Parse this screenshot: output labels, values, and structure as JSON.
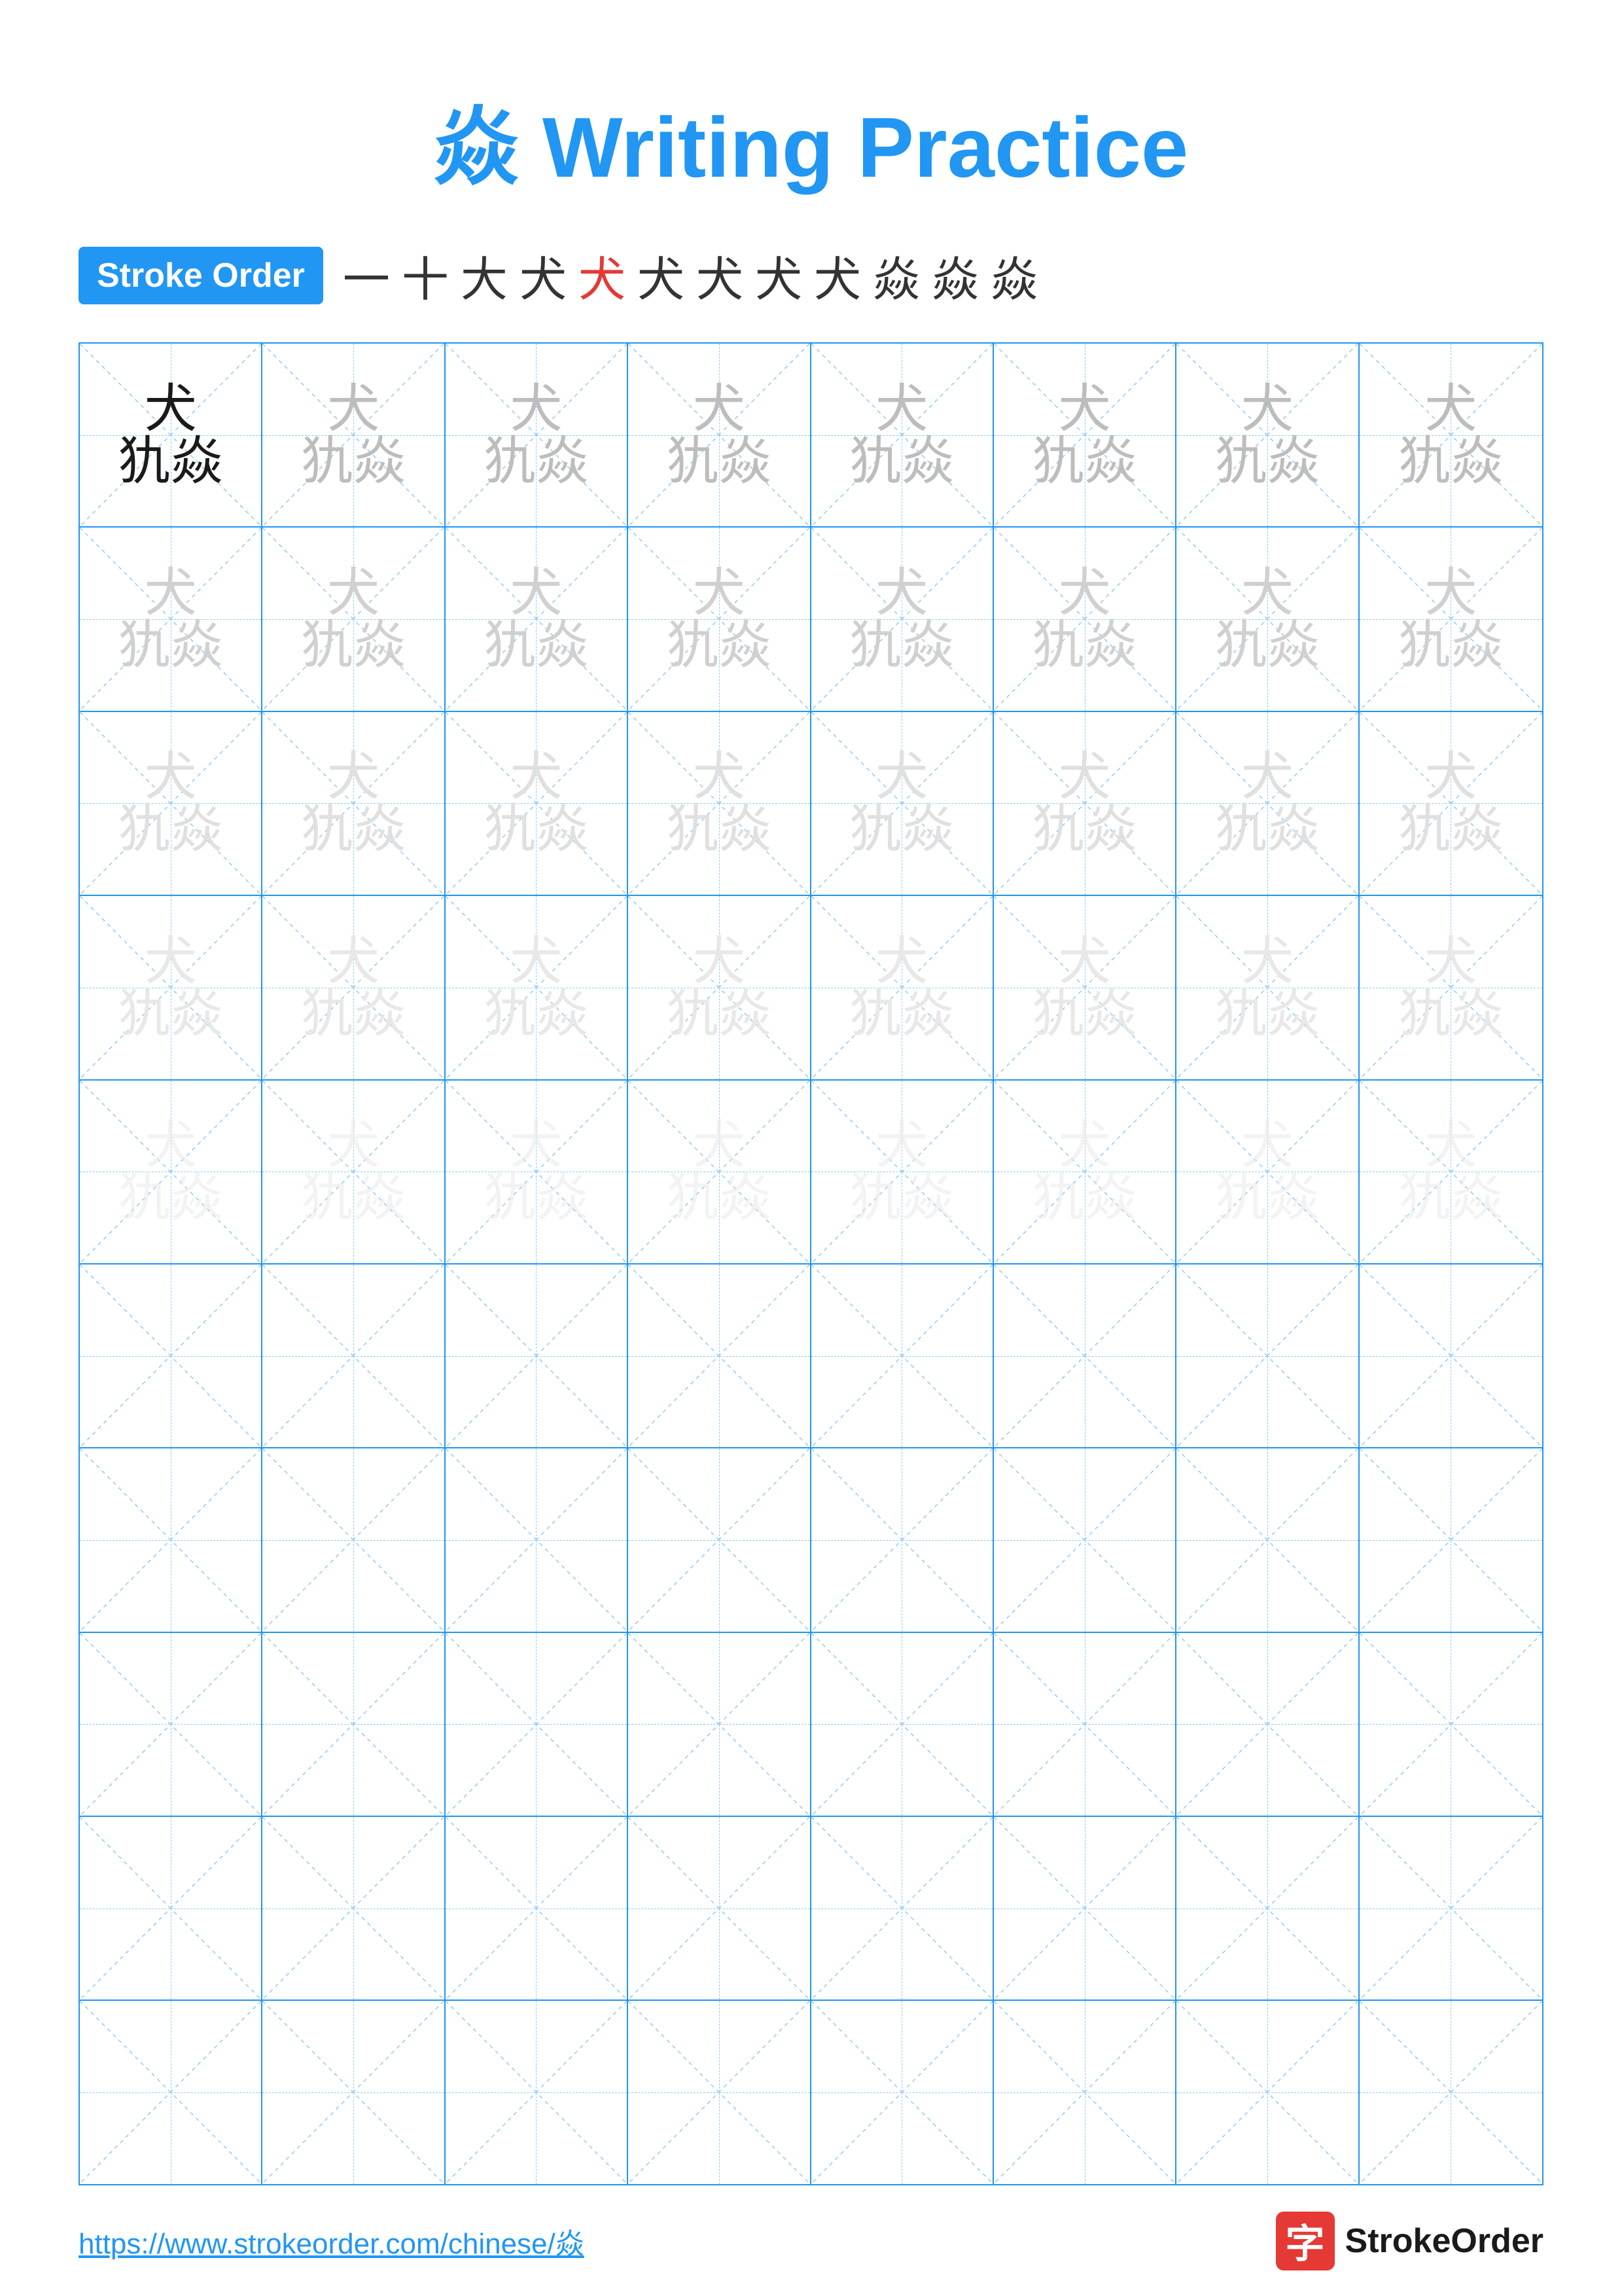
{
  "title": "焱 Writing Practice",
  "stroke_order": {
    "badge_label": "Stroke Order",
    "characters": [
      "一",
      "十",
      "大",
      "犬",
      "犬",
      "犬",
      "犬",
      "犬",
      "犬",
      "焱",
      "焱",
      "焱"
    ]
  },
  "grid": {
    "rows": 10,
    "cols": 8
  },
  "char": "焱",
  "char_split": [
    "犬",
    "犰焱"
  ],
  "footer": {
    "url": "https://www.strokeorder.com/chinese/焱",
    "logo_icon": "字",
    "logo_text": "StrokeOrder"
  }
}
